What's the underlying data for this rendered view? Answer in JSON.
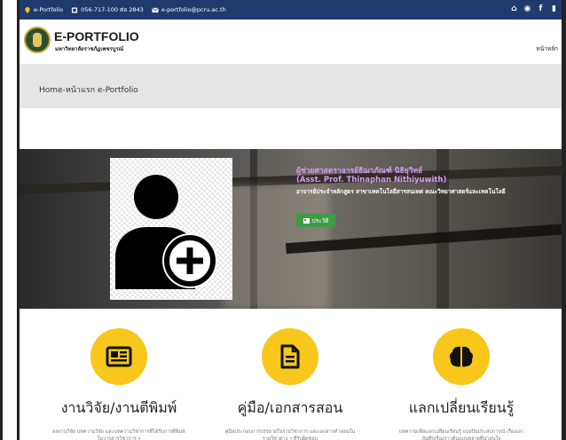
{
  "topbar": {
    "site": "e-Portfolio",
    "phone": "056-717-100 ต่อ 2843",
    "email": "e-portfolio@pcru.ac.th",
    "social_icons": [
      "home-icon",
      "globe-icon",
      "facebook-icon",
      "more-icon"
    ]
  },
  "header": {
    "brand": "E-PORTFOLIO",
    "brand_sub": "มหาวิทยาลัยราชภัฏเพชรบูรณ์",
    "nav_home": "หน้าหลัก"
  },
  "breadcrumb": {
    "text": "Home-หน้าแรก e-Portfolio"
  },
  "hero": {
    "name_th": "ผู้ช่วยศาสตราจารย์ธิฌาภัณฑ์ นิธิยุวิทย์",
    "name_en": "(Asst. Prof. Thinaphan Nithiyuwith)",
    "role": "อาจารย์ประจำหลักสูตร สาขาเทคโนโลยีสารสนเทศ คณะวิทยาศาสตร์และเทคโนโลยี",
    "cv_button": "ประวัติ"
  },
  "features": [
    {
      "icon": "newspaper-icon",
      "title": "งานวิจัย/งานตีพิมพ์",
      "desc": "ผลงานวิจัย บทความวิจัย และบทความวิชาการที่ได้รับการตีพิมพ์ในวารสารวิชาการ ๆ"
    },
    {
      "icon": "document-icon",
      "title": "คู่มือ/เอกสารสอน",
      "desc": "คู่มือประกอบการบรรยายในรายวิชาการ และเอกสารคำสอนในรายวิชาต่าง ๆ ที่รับผิดชอบ"
    },
    {
      "icon": "brain-icon",
      "title": "แลกเปลี่ยนเรียนรู้",
      "desc": "บทความเพื่อแลกเปลี่ยนเรียนรู้ แบ่งปันประสบการณ์ เรื่องเล่า บันทึกเรื่องราวต้นแบบหลายที่น่าสนใจ"
    }
  ],
  "colors": {
    "topbar": "#1f3a6d",
    "accent_yellow": "#f7c71c",
    "cv_green": "#3f9b45",
    "name_purple": "#d59cf0"
  }
}
